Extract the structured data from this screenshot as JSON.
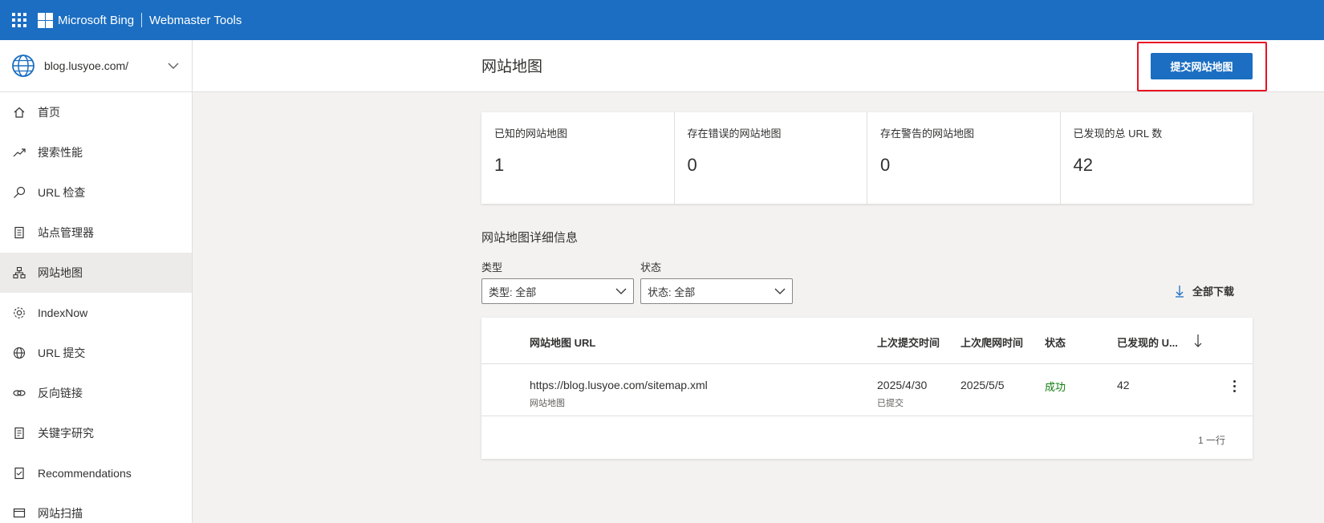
{
  "topbar": {
    "brand": "Microsoft Bing",
    "product": "Webmaster Tools",
    "color": "#1b6ec2"
  },
  "site": {
    "url": "blog.lusyoe.com/",
    "icon": "globe-icon"
  },
  "nav": [
    {
      "label": "首页",
      "icon": "home-icon",
      "active": false
    },
    {
      "label": "搜索性能",
      "icon": "trend-icon",
      "active": false
    },
    {
      "label": "URL 检查",
      "icon": "search-icon",
      "active": false
    },
    {
      "label": "站点管理器",
      "icon": "document-list-icon",
      "active": false
    },
    {
      "label": "网站地图",
      "icon": "sitemap-icon",
      "active": true
    },
    {
      "label": "IndexNow",
      "icon": "gear-icon",
      "active": false
    },
    {
      "label": "URL 提交",
      "icon": "globe-icon",
      "active": false
    },
    {
      "label": "反向链接",
      "icon": "link-icon",
      "active": false
    },
    {
      "label": "关键字研究",
      "icon": "document-icon",
      "active": false
    },
    {
      "label": "Recommendations",
      "icon": "checklist-icon",
      "active": false
    },
    {
      "label": "网站扫描",
      "icon": "scan-icon",
      "active": false
    }
  ],
  "header": {
    "title": "网站地图",
    "submit_label": "提交网站地图"
  },
  "stats": [
    {
      "label": "已知的网站地图",
      "value": "1"
    },
    {
      "label": "存在错误的网站地图",
      "value": "0"
    },
    {
      "label": "存在警告的网站地图",
      "value": "0"
    },
    {
      "label": "已发现的总 URL 数",
      "value": "42"
    }
  ],
  "details": {
    "title": "网站地图详细信息",
    "type_filter": {
      "label": "类型",
      "value": "类型: 全部"
    },
    "status_filter": {
      "label": "状态",
      "value": "状态: 全部"
    },
    "download_label": "全部下载"
  },
  "table": {
    "columns": {
      "url": "网站地图 URL",
      "submitted": "上次提交时间",
      "crawled": "上次爬网时间",
      "status": "状态",
      "discovered": "已发现的 U..."
    },
    "rows": [
      {
        "url": "https://blog.lusyoe.com/sitemap.xml",
        "type": "网站地图",
        "submitted": "2025/4/30",
        "submitted_note": "已提交",
        "crawled": "2025/5/5",
        "status": "成功",
        "discovered": "42"
      }
    ],
    "row_count": "1 一行"
  },
  "colors": {
    "accent": "#1b6ec2",
    "success": "#107c10",
    "highlight_box": "#e81123"
  }
}
